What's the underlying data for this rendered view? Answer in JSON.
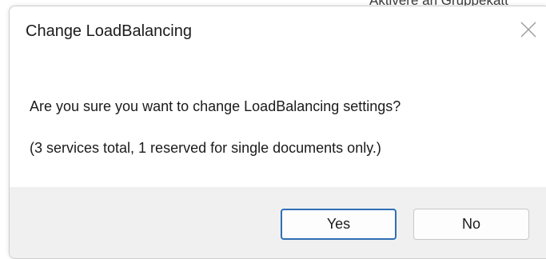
{
  "background": {
    "partial_text": "Aktivere an Gruppekatt"
  },
  "dialog": {
    "title": "Change LoadBalancing",
    "close_icon": "close-icon",
    "message": "Are you sure you want to change LoadBalancing settings?",
    "detail": "(3 services total, 1 reserved for single documents only.)",
    "buttons": {
      "yes_label": "Yes",
      "no_label": "No"
    }
  },
  "colors": {
    "footer_bg": "#f0f0f0",
    "default_button_border": "#2f6fb5",
    "button_border": "#c8c8c8",
    "text": "#1b1b1b"
  }
}
